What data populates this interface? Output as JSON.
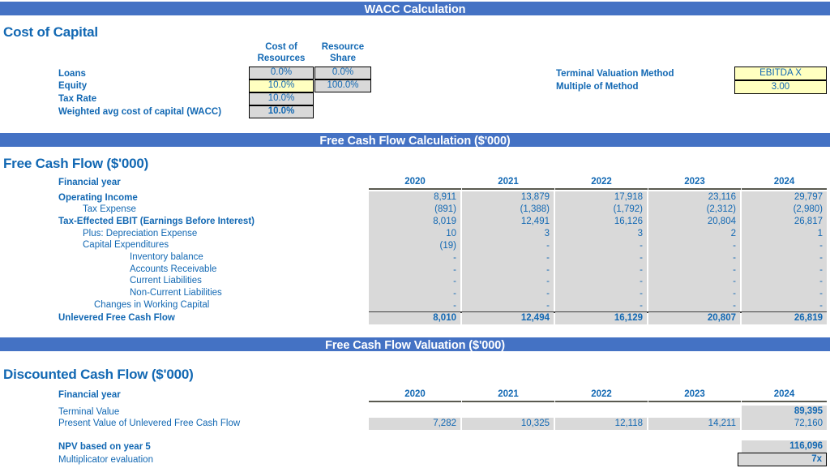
{
  "banners": {
    "wacc": "WACC Calculation",
    "fcf_calc": "Free Cash Flow Calculation ($'000)",
    "fcf_val": "Free Cash Flow Valuation ($'000)"
  },
  "cost_of_capital": {
    "heading": "Cost of Capital",
    "col_headers": [
      {
        "line1": "Cost of",
        "line2": "Resources"
      },
      {
        "line1": "Resource",
        "line2": "Share"
      }
    ],
    "rows": [
      {
        "label": "Loans",
        "cost": "0.0%",
        "share": "0.0%"
      },
      {
        "label": "Equity",
        "cost": "10.0%",
        "share": "100.0%"
      },
      {
        "label": "Tax Rate",
        "cost": "10.0%",
        "share": null
      },
      {
        "label": "Weighted avg cost of capital (WACC)",
        "cost": "10.0%",
        "share": null
      }
    ],
    "terminal": {
      "method_label": "Terminal Valuation Method",
      "method_value": "EBITDA X",
      "multiple_label": "Multiple of Method",
      "multiple_value": "3.00"
    }
  },
  "free_cash_flow": {
    "heading": "Free Cash Flow ($'000)",
    "year_label": "Financial year",
    "years": [
      "2020",
      "2021",
      "2022",
      "2023",
      "2024"
    ],
    "rows": [
      {
        "label": "Operating Income",
        "indent": 0,
        "bold": true,
        "values": [
          "8,911",
          "13,879",
          "17,918",
          "23,116",
          "29,797"
        ]
      },
      {
        "label": "Tax Expense",
        "indent": 1,
        "bold": false,
        "values": [
          "(891)",
          "(1,388)",
          "(1,792)",
          "(2,312)",
          "(2,980)"
        ]
      },
      {
        "label": "Tax-Effected EBIT (Earnings Before Interest)",
        "indent": 0,
        "bold": true,
        "values": [
          "8,019",
          "12,491",
          "16,126",
          "20,804",
          "26,817"
        ]
      },
      {
        "label": "Plus: Depreciation Expense",
        "indent": 1,
        "bold": false,
        "values": [
          "10",
          "3",
          "3",
          "2",
          "1"
        ]
      },
      {
        "label": "Capital Expenditures",
        "indent": 1,
        "bold": false,
        "values": [
          "(19)",
          "-",
          "-",
          "-",
          "-"
        ]
      },
      {
        "label": "Inventory balance",
        "indent": 2,
        "bold": false,
        "values": [
          "-",
          "-",
          "-",
          "-",
          "-"
        ]
      },
      {
        "label": "Accounts Receivable",
        "indent": 2,
        "bold": false,
        "values": [
          "-",
          "-",
          "-",
          "-",
          "-"
        ]
      },
      {
        "label": "Current Liabilities",
        "indent": 2,
        "bold": false,
        "values": [
          "-",
          "-",
          "-",
          "-",
          "-"
        ]
      },
      {
        "label": "Non-Current Liabilities",
        "indent": 2,
        "bold": false,
        "values": [
          "-",
          "-",
          "-",
          "-",
          "-"
        ]
      },
      {
        "label": "Changes in Working Capital",
        "indent": 1,
        "bold": false,
        "values": [
          "-",
          "-",
          "-",
          "-",
          "-"
        ]
      }
    ],
    "total_row": {
      "label": "Unlevered Free Cash Flow",
      "values": [
        "8,010",
        "12,494",
        "16,129",
        "20,807",
        "26,819"
      ]
    }
  },
  "discounted_cash_flow": {
    "heading": "Discounted Cash Flow ($'000)",
    "year_label": "Financial year",
    "years": [
      "2020",
      "2021",
      "2022",
      "2023",
      "2024"
    ],
    "rows": [
      {
        "label": "Terminal Value",
        "bold": false,
        "values": [
          "",
          "",
          "",
          "",
          "89,395"
        ],
        "bold_values": true
      },
      {
        "label": "Present Value of Unlevered Free Cash Flow",
        "bold": false,
        "values": [
          "7,282",
          "10,325",
          "12,118",
          "14,211",
          "72,160"
        ],
        "bold_values": false
      }
    ],
    "npv": {
      "label": "NPV based on year 5",
      "value": "116,096"
    },
    "multiplicator": {
      "label": "Multiplicator evaluation",
      "value": "7x"
    }
  },
  "colors": {
    "banner_blue": "#4472C4",
    "text_blue": "#1268B3",
    "cell_gray": "#D9D9D9",
    "input_yellow": "#FFFFC0"
  }
}
